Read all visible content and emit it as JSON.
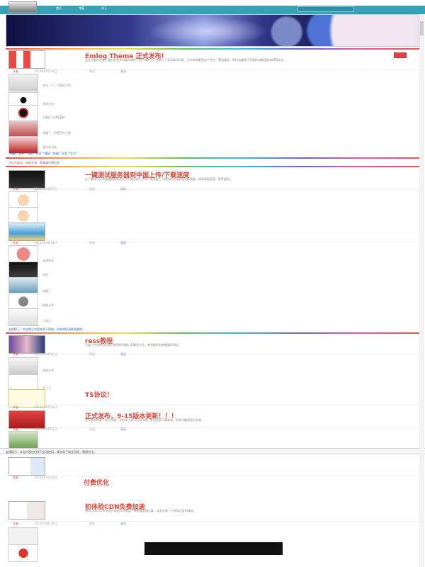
{
  "nav": {
    "items": [
      "首页",
      "博客",
      "关于"
    ],
    "search_placeholder": ""
  },
  "featured": {
    "title": "Emlog Theme 正式发布!",
    "summary": "这次主题的开发，我们把更多的精力放在了用户体验上，并融入了多项实用功能，让你的博客更加个性化，更加美观，同时也兼顾了页面的加载速度和SEO优化。",
    "meta": [
      "作者",
      "2014年09月20日",
      "评论",
      "阅读"
    ]
  },
  "comments_a": [
    {
      "name": "访客",
      "text": "支持一下，主题很不错"
    },
    {
      "name": "博主",
      "text": "谢谢支持"
    },
    {
      "name": "访客",
      "text": "主题什么时候更新"
    },
    {
      "name": "访客",
      "text": "收藏了，很漂亮的主题"
    },
    {
      "name": "访客",
      "text": "期待新功能"
    }
  ],
  "tags_line": "“博客”“设计”“主题”“分享”“模板”“前端”“开发”“生活”",
  "sub_line": "评论与留言，欢迎交流，转载请注明出处",
  "post2": {
    "title": "一键测试服务器到中国上传/下载速度",
    "summary": "这个脚本可以测试服务器到国内多个地区的上传和下载速度，方便选择合适的服务器线路，结果清晰直观，推荐使用。",
    "meta": [
      "作者",
      "2014年09月15日",
      "评论",
      "阅读"
    ]
  },
  "post3": {
    "title": "",
    "summary": "",
    "meta": [
      "作者",
      "2014年09月13日",
      "评论",
      "阅读"
    ]
  },
  "comments_b": [
    {
      "name": "访客",
      "text": "测速很准"
    },
    {
      "name": "访客",
      "text": "好用"
    },
    {
      "name": "访客",
      "text": "收藏了"
    },
    {
      "name": "访客",
      "text": "谢谢分享"
    },
    {
      "name": "访客",
      "text": "已测试"
    }
  ],
  "notice": "友情提示：本站部分内容来源于网络，如有侵权请联系删除。",
  "post4": {
    "title": "ress教程",
    "summary": "记录一些在使用过程中遇到的问题以及解决方法，希望能帮到有需要的朋友。",
    "meta": [
      "作者",
      "2014年09月10日",
      "评论",
      "阅读"
    ]
  },
  "comments_c": [
    {
      "name": "访客",
      "text": "谢谢分享"
    },
    {
      "name": "小天",
      "text": "学习了"
    }
  ],
  "post5": {
    "title": "TS协议！",
    "meta": [
      "作者",
      "2014年09月08日"
    ]
  },
  "post6": {
    "title": "正式发布，9-15版本更新！！！",
    "summary": "本次更新修复了若干问题，并新增了部分实用功能，欢迎大家下载使用，如有问题请留言反馈。",
    "meta": [
      "作者",
      "2014年09月05日",
      "评论",
      "阅读"
    ]
  },
  "notice2": "友情提示：本站内容仅供学习交流使用，请勿用于商业用途，谢谢合作。",
  "post7": {
    "title": "付费优化",
    "meta": [
      "作者",
      "2014年09月02日"
    ]
  },
  "post8": {
    "title": "初体验CDN免费加速",
    "summary": "使用CDN可以有效提升网站访问速度，降低服务器负载，这里记录一下使用过程和体验。",
    "meta": [
      "作者",
      "2014年08月30日",
      "评论",
      "阅读"
    ]
  },
  "footer_box": {
    "line1": "",
    "line2": ""
  }
}
